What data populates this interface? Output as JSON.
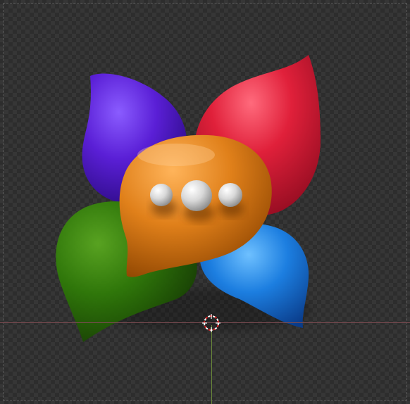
{
  "viewport": {
    "background": "checkerboard",
    "colors": {
      "checker_dark": "#2d2d2d",
      "checker_light": "#363636",
      "axis_x": "#7a4a50",
      "axis_z": "#6b8a3a"
    }
  },
  "model": {
    "name": "",
    "petals": [
      {
        "name": "purple-petal",
        "color": "#5a1fd6"
      },
      {
        "name": "red-petal",
        "color": "#e0203a"
      },
      {
        "name": "green-petal",
        "color": "#2f7a08"
      },
      {
        "name": "blue-petal",
        "color": "#1c7ee0"
      }
    ],
    "bubble": {
      "color": "#e0801a",
      "dots": 3
    }
  },
  "icons": {
    "cursor": "3d-cursor-icon"
  }
}
